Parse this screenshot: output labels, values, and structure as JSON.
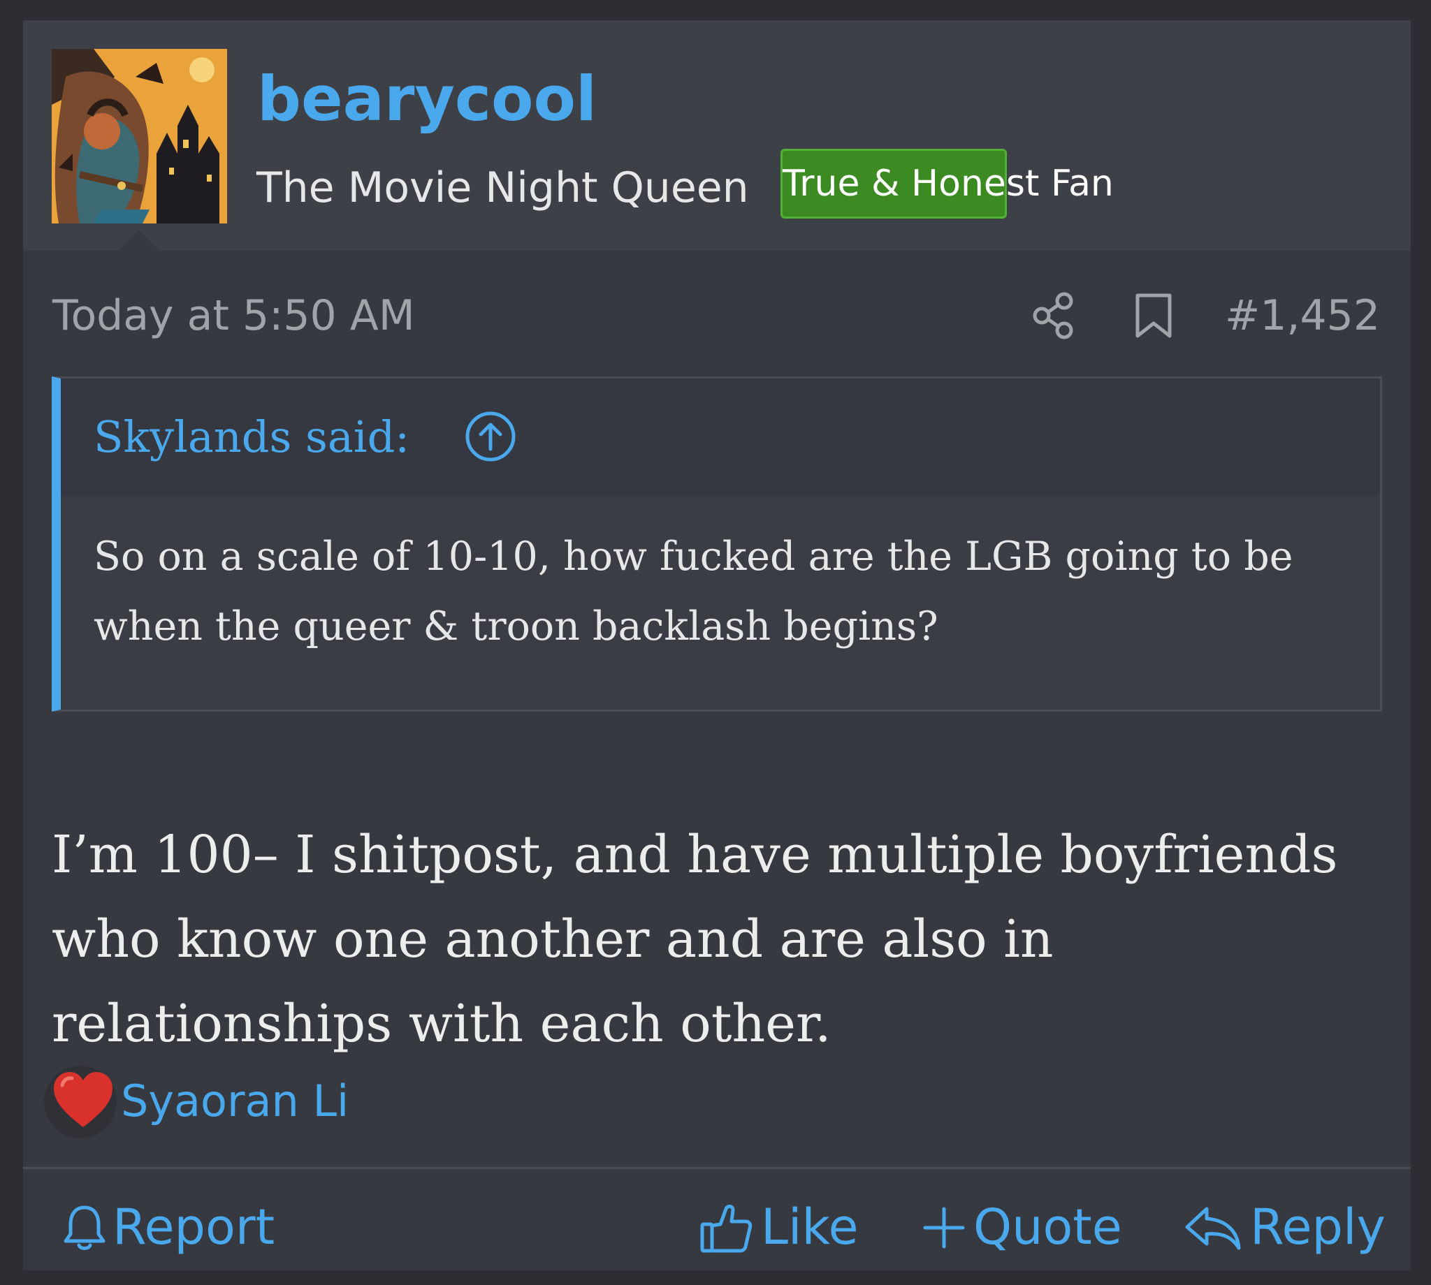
{
  "post": {
    "author": {
      "username": "bearycool",
      "title": "The Movie Night Queen",
      "banner": "True & Honest Fan",
      "avatar_icon": "user-avatar-illustration"
    },
    "meta": {
      "date": "Today at 5:50 AM",
      "post_number": "#1,452",
      "share_icon": "share-icon",
      "bookmark_icon": "bookmark-icon"
    },
    "quote": {
      "author_line": "Skylands said:",
      "arrow_icon": "arrow-up-circle-icon",
      "text": "So on a scale of 10-10, how fucked are the LGB going to be when the queer & troon backlash begins?"
    },
    "body": "I’m 100– I shitpost, and have multiple boyfriends who know one another and are also in relationships with each other.",
    "reactions": {
      "icon": "heart-icon",
      "users": "Syaoran Li"
    },
    "actions": {
      "report": "Report",
      "like": "Like",
      "quote": "Quote",
      "reply": "Reply"
    }
  },
  "colors": {
    "page_bg": "#2c2e33",
    "card_bg": "#36393f",
    "header_bg": "#3d4047",
    "accent_blue": "#4aa8ec",
    "banner_green": "#3b8a22",
    "text_primary": "#e6e7e9",
    "text_muted": "#a0a3a8",
    "heart_red": "#d9312b"
  }
}
